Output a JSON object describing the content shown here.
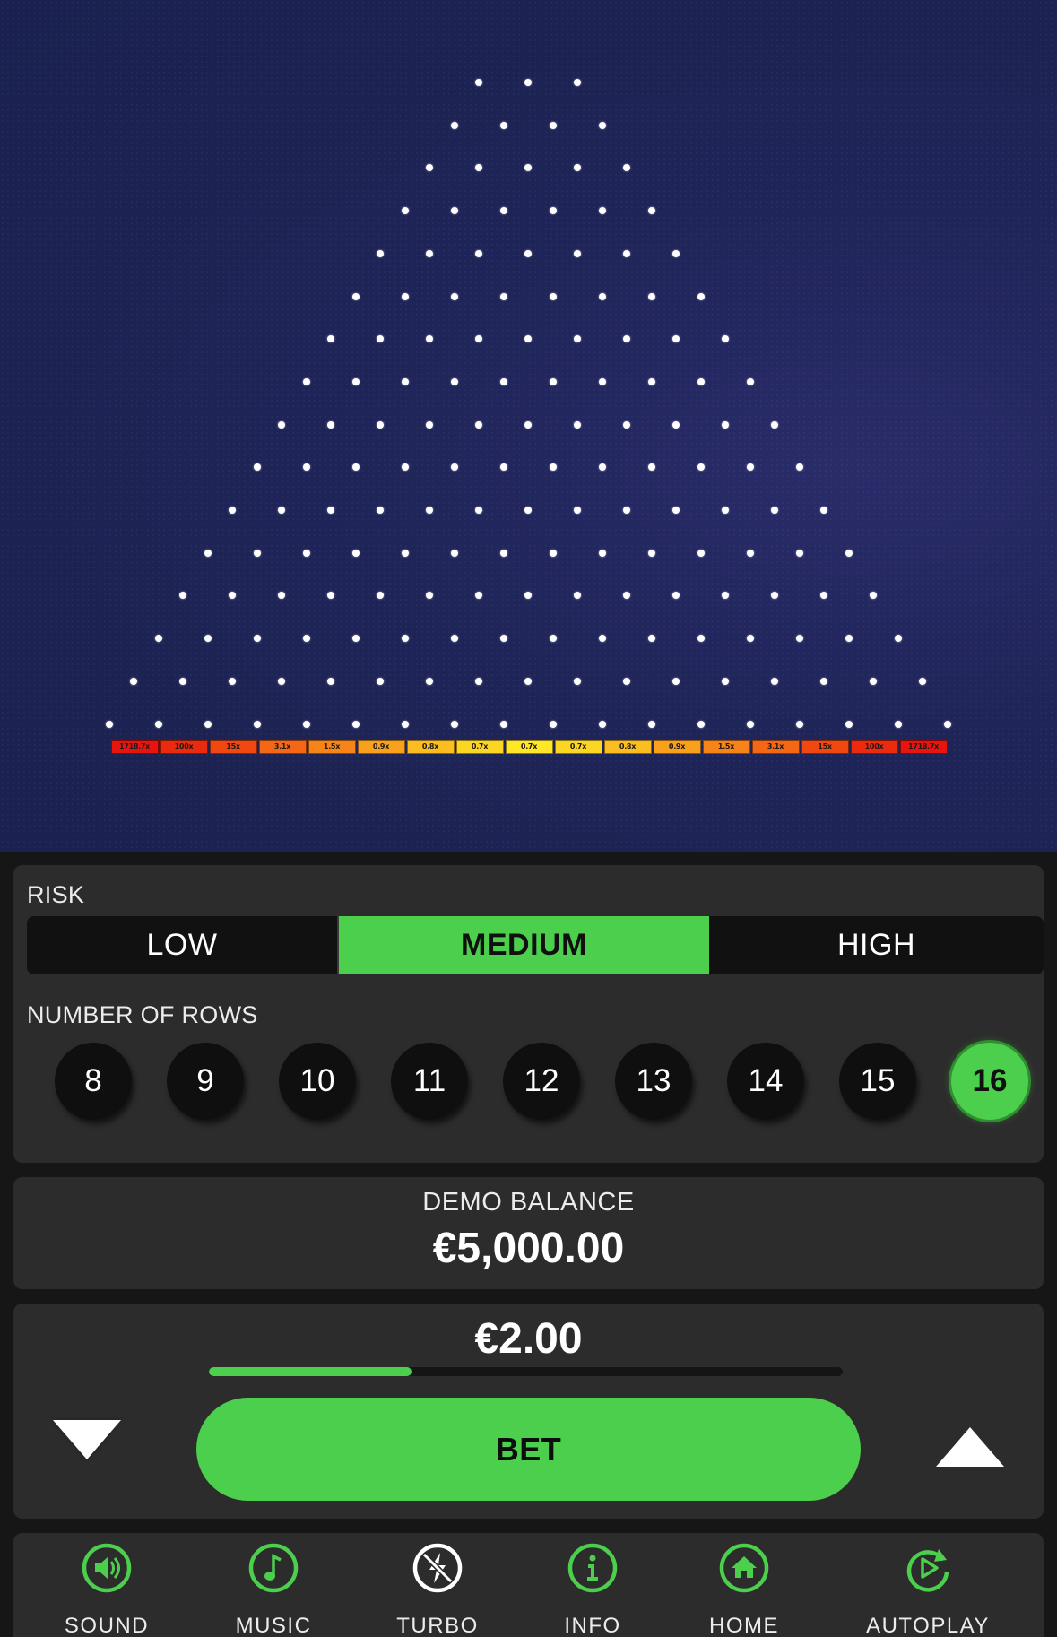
{
  "board": {
    "rows": 16,
    "buckets": [
      {
        "label": "1718.7x",
        "color": "#e8150f"
      },
      {
        "label": "100x",
        "color": "#ec2a0e"
      },
      {
        "label": "15x",
        "color": "#f04810"
      },
      {
        "label": "3.1x",
        "color": "#f46714"
      },
      {
        "label": "1.5x",
        "color": "#f78418"
      },
      {
        "label": "0.9x",
        "color": "#f9a11b"
      },
      {
        "label": "0.8x",
        "color": "#fbbd1f"
      },
      {
        "label": "0.7x",
        "color": "#fdd623"
      },
      {
        "label": "0.7x",
        "color": "#ffe626"
      },
      {
        "label": "0.7x",
        "color": "#fdd623"
      },
      {
        "label": "0.8x",
        "color": "#fbbd1f"
      },
      {
        "label": "0.9x",
        "color": "#f9a11b"
      },
      {
        "label": "1.5x",
        "color": "#f78418"
      },
      {
        "label": "3.1x",
        "color": "#f46714"
      },
      {
        "label": "15x",
        "color": "#f04810"
      },
      {
        "label": "100x",
        "color": "#ec2a0e"
      },
      {
        "label": "1718.7x",
        "color": "#e8150f"
      }
    ]
  },
  "risk": {
    "label": "RISK",
    "options": [
      "LOW",
      "MEDIUM",
      "HIGH"
    ],
    "selected": "MEDIUM"
  },
  "rows_selector": {
    "label": "NUMBER OF ROWS",
    "options": [
      "8",
      "9",
      "10",
      "11",
      "12",
      "13",
      "14",
      "15",
      "16"
    ],
    "selected": "16"
  },
  "balance": {
    "label": "DEMO BALANCE",
    "value": "€5,000.00"
  },
  "bet": {
    "amount": "€2.00",
    "level_fraction": 0.32,
    "button_label": "BET"
  },
  "toolbar": {
    "items": [
      {
        "label": "SOUND",
        "icon": "speaker-icon"
      },
      {
        "label": "MUSIC",
        "icon": "music-note-icon"
      },
      {
        "label": "TURBO",
        "icon": "turbo-off-icon"
      },
      {
        "label": "INFO",
        "icon": "info-icon"
      },
      {
        "label": "HOME",
        "icon": "home-icon"
      },
      {
        "label": "AUTOPLAY",
        "icon": "autoplay-icon"
      }
    ]
  },
  "colors": {
    "accent": "#4ccf4c",
    "board_bg": "#1c2352",
    "panel_bg": "#2c2c2c"
  }
}
